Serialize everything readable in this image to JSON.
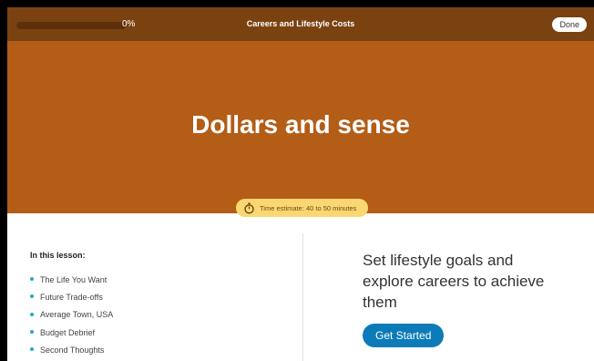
{
  "topbar": {
    "progress_text": "0%",
    "progress_fraction": 0,
    "title": "Careers and Lifestyle Costs",
    "done_label": "Done"
  },
  "hero": {
    "title": "Dollars and sense",
    "time_estimate": "Time estimate: 40 to 50 minutes"
  },
  "lesson": {
    "heading": "In this lesson:",
    "items": [
      {
        "label": "The Life You Want"
      },
      {
        "label": "Future Trade-offs"
      },
      {
        "label": "Average Town, USA"
      },
      {
        "label": "Budget Debrief"
      },
      {
        "label": "Second Thoughts"
      }
    ]
  },
  "cta": {
    "text": "Set lifestyle goals and explore careers to achieve them",
    "button_label": "Get Started"
  },
  "icons": {
    "time_icon": "stopwatch-icon",
    "list_marker": "bullet-dot"
  },
  "colors": {
    "topbar": "#7a4210",
    "hero": "#b35d17",
    "pill": "#fbd774",
    "bullet": "#27a8c4",
    "button": "#0c7bb8"
  }
}
